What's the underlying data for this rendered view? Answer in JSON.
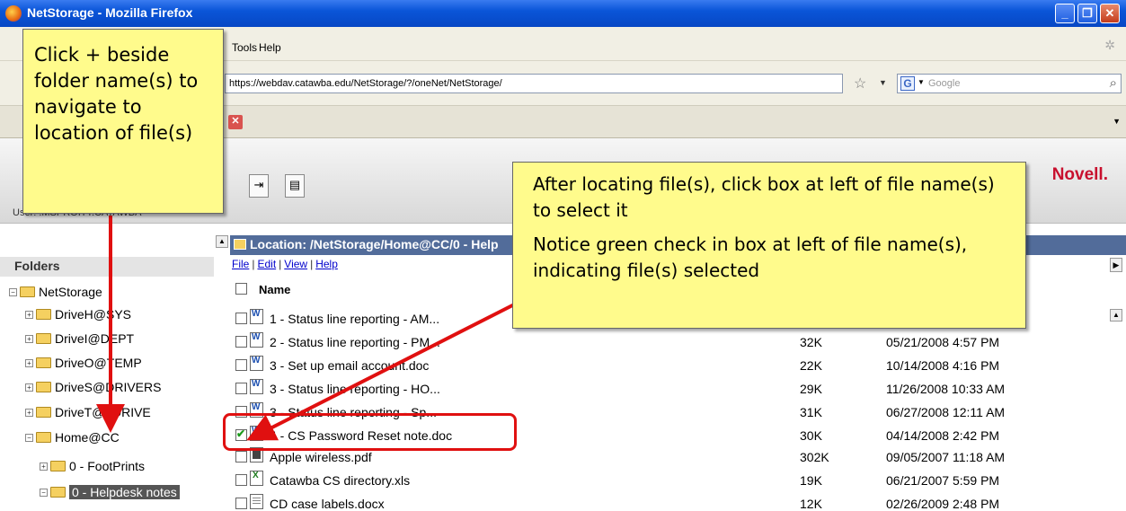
{
  "window": {
    "title": "NetStorage - Mozilla Firefox"
  },
  "menubar": {
    "tools": "Tools",
    "help": "Help"
  },
  "navbar": {
    "url": "https://webdav.catawba.edu/NetStorage/?/oneNet/NetStorage/",
    "search_placeholder": "Google"
  },
  "header": {
    "brand": "Novell.",
    "user": "User: .MSPROITT.CATAWBA"
  },
  "folders": {
    "header": "Folders",
    "items": [
      {
        "label": "NetStorage",
        "expander": "−"
      },
      {
        "label": "DriveH@SYS",
        "expander": "+"
      },
      {
        "label": "DriveI@DEPT",
        "expander": "+"
      },
      {
        "label": "DriveO@TEMP",
        "expander": "+"
      },
      {
        "label": "DriveS@DRIVERS",
        "expander": "+"
      },
      {
        "label": "DriveT@TDRIVE",
        "expander": "+"
      },
      {
        "label": "Home@CC",
        "expander": "−"
      },
      {
        "label": "0 - FootPrints",
        "expander": "+"
      },
      {
        "label": "0 - Helpdesk notes",
        "expander": "−"
      }
    ]
  },
  "filepane": {
    "location": "Location: /NetStorage/Home@CC/0 - Help",
    "menu": [
      "File",
      "Edit",
      "View",
      "Help"
    ],
    "col_name": "Name",
    "files": [
      {
        "name": "1 - Status line reporting - AM...",
        "size": "",
        "date": "",
        "checked": false,
        "icon": "doc"
      },
      {
        "name": "2 - Status line reporting - PM...",
        "size": "32K",
        "date": "05/21/2008 4:57 PM",
        "checked": false,
        "icon": "doc"
      },
      {
        "name": "3 - Set up email account.doc",
        "size": "22K",
        "date": "10/14/2008 4:16 PM",
        "checked": false,
        "icon": "doc"
      },
      {
        "name": "3 - Status line reporting - HO...",
        "size": "29K",
        "date": "11/26/2008 10:33 AM",
        "checked": false,
        "icon": "doc"
      },
      {
        "name": "3 - Status line reporting - Sp...",
        "size": "31K",
        "date": "06/27/2008 12:11 AM",
        "checked": false,
        "icon": "doc"
      },
      {
        "name": "4 - CS Password Reset note.doc",
        "size": "30K",
        "date": "04/14/2008 2:42 PM",
        "checked": true,
        "icon": "doc"
      },
      {
        "name": "Apple wireless.pdf",
        "size": "302K",
        "date": "09/05/2007 11:18 AM",
        "checked": false,
        "icon": "pdf"
      },
      {
        "name": "Catawba CS directory.xls",
        "size": "19K",
        "date": "06/21/2007 5:59 PM",
        "checked": false,
        "icon": "xls"
      },
      {
        "name": "CD case labels.docx",
        "size": "12K",
        "date": "02/26/2009 2:48 PM",
        "checked": false,
        "icon": "docx"
      }
    ]
  },
  "callouts": {
    "left": "Click + beside folder name(s) to navigate to location of file(s)",
    "right_1": "After locating file(s), click box at left of file name(s) to select it",
    "right_2": "Notice green check in box at left of file name(s), indicating file(s) selected"
  }
}
